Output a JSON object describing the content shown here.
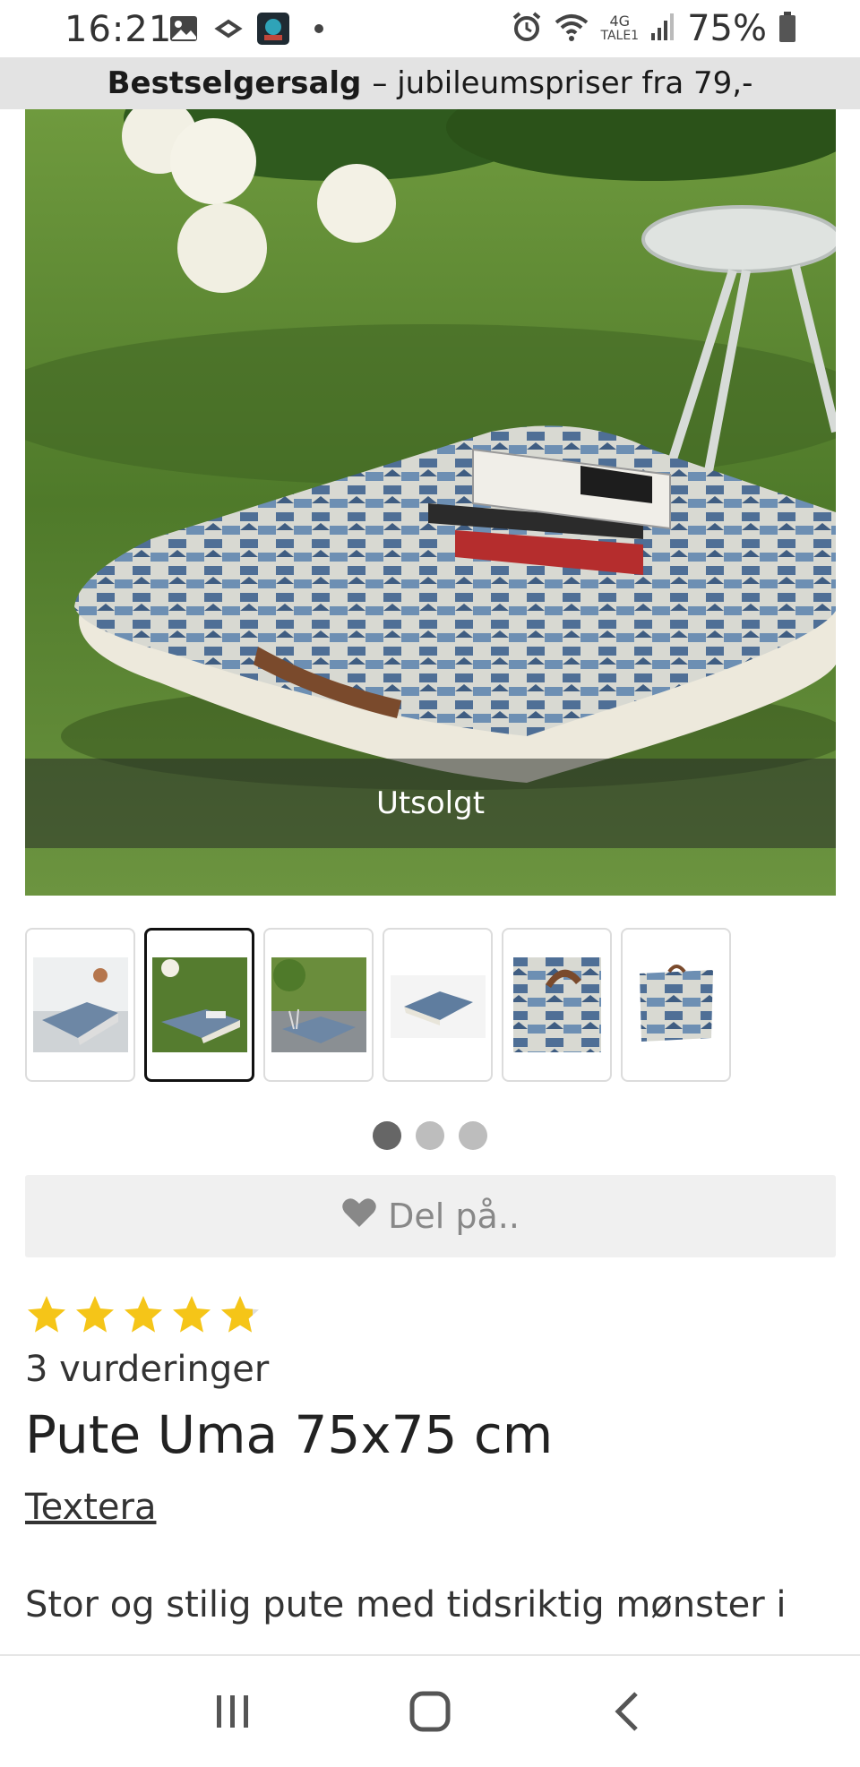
{
  "status_bar": {
    "time": "16:21",
    "network": "4G",
    "network_sub": "TALE1",
    "battery": "75%",
    "icons": [
      "gallery-icon",
      "cloud-icon",
      "app-icon",
      "dot-icon",
      "alarm-icon",
      "wifi-icon",
      "signal-icon",
      "battery-icon"
    ]
  },
  "promo": {
    "bold": "Bestselgersalg",
    "text": "– jubileumspriser fra 79,-"
  },
  "hero": {
    "overlay_label": "Utsolgt"
  },
  "thumbnails": {
    "count": 6,
    "active_index": 1
  },
  "pager": {
    "count": 3,
    "active_index": 0
  },
  "share": {
    "label": "Del på.."
  },
  "rating": {
    "value": 4.8,
    "max": 5,
    "star_color": "#f5c518",
    "reviews_label": "3 vurderinger"
  },
  "product": {
    "title": "Pute Uma 75x75 cm",
    "brand": "Textera",
    "description": "Stor og stilig pute med tidsriktig mønster i"
  },
  "nav": {
    "icons": [
      "recent-apps-icon",
      "home-icon",
      "back-icon"
    ]
  }
}
